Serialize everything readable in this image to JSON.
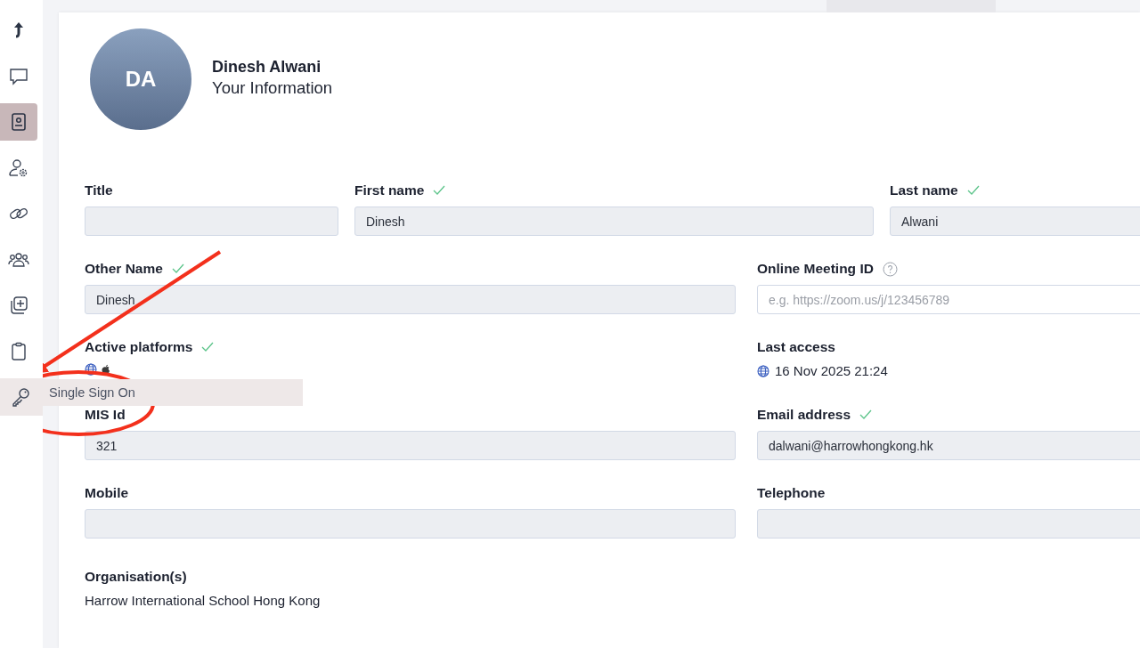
{
  "sidebar": {
    "items": [
      {
        "kind": "up-arrow",
        "selected": false,
        "hovered": false
      },
      {
        "kind": "chat",
        "selected": false,
        "hovered": false
      },
      {
        "kind": "contact-card",
        "selected": true,
        "hovered": false
      },
      {
        "kind": "user-gear",
        "selected": false,
        "hovered": false
      },
      {
        "kind": "link",
        "selected": false,
        "hovered": false
      },
      {
        "kind": "people",
        "selected": false,
        "hovered": false
      },
      {
        "kind": "copy-plus",
        "selected": false,
        "hovered": false
      },
      {
        "kind": "clipboard",
        "selected": false,
        "hovered": false
      },
      {
        "kind": "key",
        "selected": false,
        "hovered": true
      }
    ],
    "tooltip": "Single Sign On"
  },
  "profile": {
    "initials": "DA",
    "name": "Dinesh Alwani",
    "subtitle": "Your Information"
  },
  "fields": [
    [
      {
        "kind": "input",
        "label": "Title",
        "verified": false
      },
      {
        "kind": "input",
        "label": "First name",
        "verified": true,
        "value": "Dinesh"
      },
      {
        "kind": "input",
        "label": "Last name",
        "verified": true,
        "value": "Alwani"
      }
    ],
    [
      {
        "kind": "input",
        "label": "Other Name",
        "verified": true,
        "value": "Dinesh"
      },
      {
        "kind": "input",
        "label": "Online Meeting ID",
        "verified": false,
        "help": true,
        "placeholder": "e.g. https://zoom.us/j/123456789"
      }
    ],
    [
      {
        "kind": "platforms",
        "label": "Active platforms",
        "verified": true,
        "platforms": [
          {
            "kind": "web"
          },
          {
            "kind": "apple"
          }
        ]
      },
      {
        "kind": "access",
        "label": "Last access",
        "verified": false,
        "value": "16 Nov 2025 21:24"
      }
    ],
    [
      {
        "kind": "input",
        "label": "MIS Id",
        "verified": false,
        "value": "321"
      },
      {
        "kind": "input",
        "label": "Email address",
        "verified": true,
        "value": "dalwani@harrowhongkong.hk"
      }
    ],
    [
      {
        "kind": "input",
        "label": "Mobile",
        "verified": false
      },
      {
        "kind": "input",
        "label": "Telephone",
        "verified": false
      }
    ],
    [
      {
        "kind": "text",
        "label": "Organisation(s)",
        "verified": false,
        "value": "Harrow International School Hong Kong"
      }
    ]
  ]
}
